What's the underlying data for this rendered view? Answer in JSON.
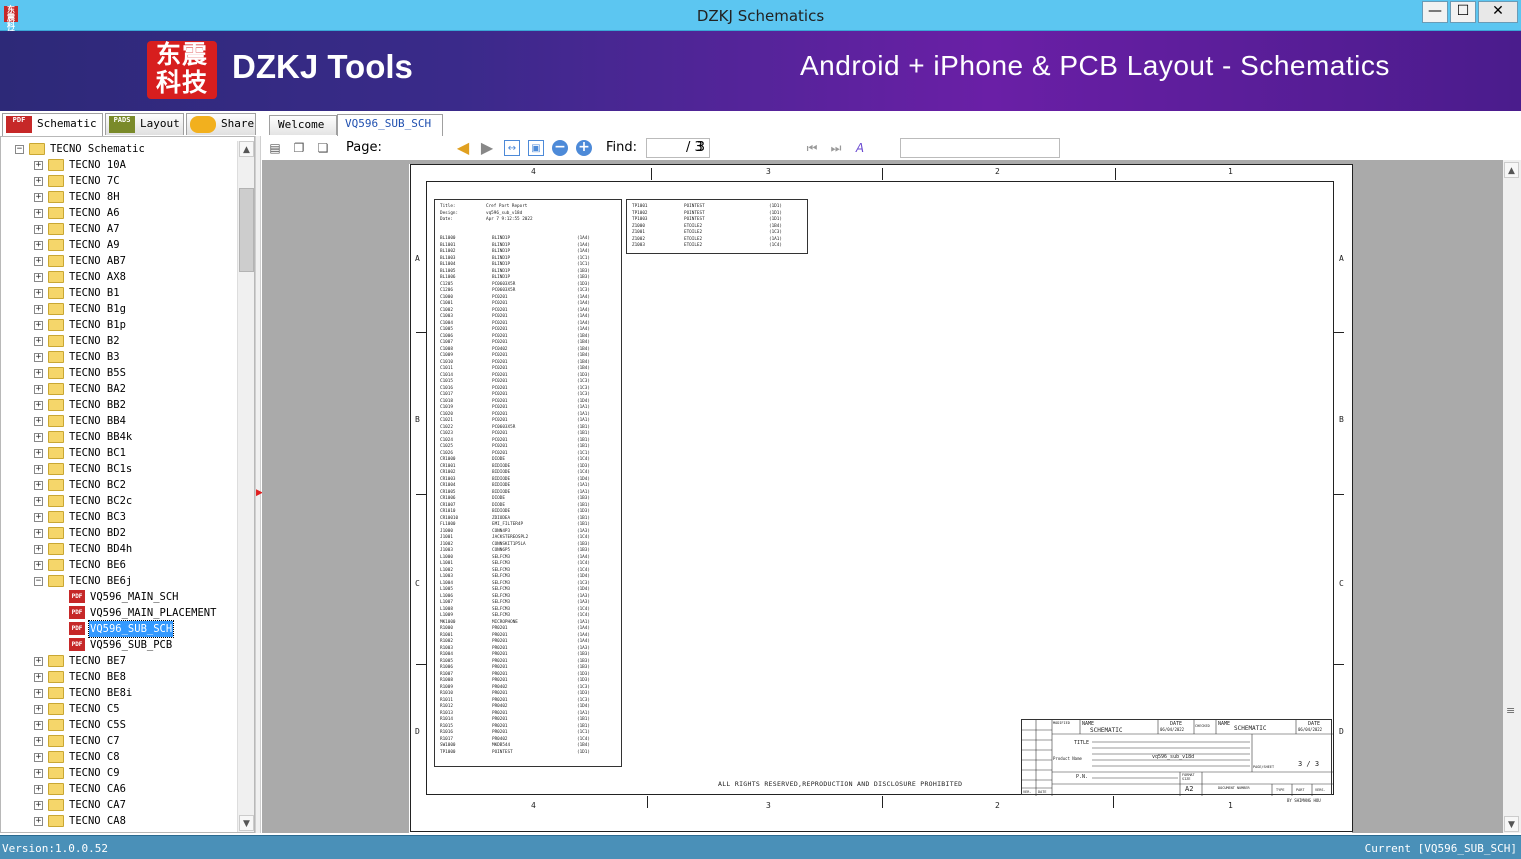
{
  "window": {
    "title": "DZKJ Schematics",
    "app_icon_text": "东震科技",
    "minimize": "—",
    "maximize": "☐",
    "close": "✕"
  },
  "banner": {
    "logo_text": "东震科技",
    "brand": "DZKJ Tools",
    "tagline": "Android + iPhone & PCB Layout - Schematics"
  },
  "left_tabs": [
    {
      "label": "Schematic",
      "icon": "pdf-icon",
      "icon_text": "PDF"
    },
    {
      "label": "Layout",
      "icon": "pads-icon",
      "icon_text": "PADS"
    },
    {
      "label": "Share",
      "icon": "share-icon",
      "icon_text": ""
    }
  ],
  "doc_tabs": [
    {
      "label": "Welcome"
    },
    {
      "label": "VQ596_SUB_SCH"
    }
  ],
  "tree": {
    "root": "TECNO Schematic",
    "folders_before": [
      "TECNO 10A",
      "TECNO 7C",
      "TECNO 8H",
      "TECNO A6",
      "TECNO A7",
      "TECNO A9",
      "TECNO AB7",
      "TECNO AX8",
      "TECNO B1",
      "TECNO B1g",
      "TECNO B1p",
      "TECNO B2",
      "TECNO B3",
      "TECNO B5S",
      "TECNO BA2",
      "TECNO BB2",
      "TECNO BB4",
      "TECNO BB4k",
      "TECNO BC1",
      "TECNO BC1s",
      "TECNO BC2",
      "TECNO BC2c",
      "TECNO BC3",
      "TECNO BD2",
      "TECNO BD4h",
      "TECNO BE6"
    ],
    "expanded_folder": "TECNO BE6j",
    "files": [
      "VQ596_MAIN_SCH",
      "VQ596_MAIN_PLACEMENT",
      "VQ596_SUB_SCH",
      "VQ596_SUB_PCB"
    ],
    "selected_file": "VQ596_SUB_SCH",
    "folders_after": [
      "TECNO BE7",
      "TECNO BE8",
      "TECNO BE8i",
      "TECNO C5",
      "TECNO C5S",
      "TECNO C7",
      "TECNO C8",
      "TECNO C9",
      "TECNO CA6",
      "TECNO CA7",
      "TECNO CA8"
    ]
  },
  "toolbar": {
    "page_label": "Page:",
    "page_current": "3",
    "page_total": "/ 3",
    "find_label": "Find:",
    "find_value": ""
  },
  "sheet": {
    "col_labels": [
      "4",
      "3",
      "2",
      "1"
    ],
    "row_labels": [
      "A",
      "B",
      "C",
      "D"
    ],
    "bom_header": [
      [
        "Title:",
        "Cref Part Report"
      ],
      [
        "Design:",
        "vq596_sub_v18d"
      ],
      [
        "Date:",
        "Apr 7 9:12:55 2022"
      ]
    ],
    "bom_rows": [
      [
        "BL1000",
        "BLIND1P",
        "(1A4)"
      ],
      [
        "BL1001",
        "BLIND1P",
        "(1A4)"
      ],
      [
        "BL1002",
        "BLIND1P",
        "(1A4)"
      ],
      [
        "BL1003",
        "BLIND1P",
        "(1C1)"
      ],
      [
        "BL1004",
        "BLIND1P",
        "(1C1)"
      ],
      [
        "BL1005",
        "BLIND1P",
        "(1B3)"
      ],
      [
        "BL1006",
        "BLIND1P",
        "(1B3)"
      ],
      [
        "C1205",
        "PC0603X5R",
        "(1D3)"
      ],
      [
        "C1206",
        "PC0603X5R",
        "(1C3)"
      ],
      [
        "C1000",
        "PC0201",
        "(1A4)"
      ],
      [
        "C1001",
        "PC0201",
        "(1A4)"
      ],
      [
        "C1002",
        "PC0201",
        "(1A4)"
      ],
      [
        "C1003",
        "PC0201",
        "(1A4)"
      ],
      [
        "C1004",
        "PC0201",
        "(1A4)"
      ],
      [
        "C1005",
        "PC0201",
        "(1A4)"
      ],
      [
        "C1006",
        "PC0201",
        "(1B4)"
      ],
      [
        "C1007",
        "PC0201",
        "(1B4)"
      ],
      [
        "C1008",
        "PC0402",
        "(1B4)"
      ],
      [
        "C1009",
        "PC0201",
        "(1B4)"
      ],
      [
        "C1010",
        "PC0201",
        "(1B4)"
      ],
      [
        "C1011",
        "PC0201",
        "(1B4)"
      ],
      [
        "C1014",
        "PC0201",
        "(1D3)"
      ],
      [
        "C1015",
        "PC0201",
        "(1C3)"
      ],
      [
        "C1016",
        "PC0201",
        "(1C3)"
      ],
      [
        "C1017",
        "PC0201",
        "(1C3)"
      ],
      [
        "C1018",
        "PC0201",
        "(1D4)"
      ],
      [
        "C1019",
        "PC0201",
        "(1A1)"
      ],
      [
        "C1020",
        "PC0201",
        "(1A1)"
      ],
      [
        "C1021",
        "PC0201",
        "(1A1)"
      ],
      [
        "C1022",
        "PC0603X5R",
        "(1B1)"
      ],
      [
        "C1023",
        "PC0201",
        "(1B1)"
      ],
      [
        "C1024",
        "PC0201",
        "(1B1)"
      ],
      [
        "C1025",
        "PC0201",
        "(1B1)"
      ],
      [
        "C1026",
        "PC0201",
        "(1C1)"
      ],
      [
        "CR1000",
        "DIODE",
        "(1C4)"
      ],
      [
        "CR1001",
        "BIDIODE",
        "(1D3)"
      ],
      [
        "CR1002",
        "BIDIODE",
        "(1C4)"
      ],
      [
        "CR1003",
        "BIDIODE",
        "(1D4)"
      ],
      [
        "CR1004",
        "BIDIODE",
        "(1A1)"
      ],
      [
        "CR1005",
        "BIDIODE",
        "(1A1)"
      ],
      [
        "CR1006",
        "DIODE",
        "(1B3)"
      ],
      [
        "CR1007",
        "DIODE",
        "(1B1)"
      ],
      [
        "CR1010",
        "BIDIODE",
        "(1D3)"
      ],
      [
        "CR10010",
        "ZDIODEA",
        "(1B1)"
      ],
      [
        "FL1000",
        "EMI_FILTER4P",
        "(1B1)"
      ],
      [
        "J1000",
        "CONN4P3",
        "(1A3)"
      ],
      [
        "J1001",
        "JACKSTEREOSPL2",
        "(1C4)"
      ],
      [
        "J1002",
        "CONNSKIT1P5LA",
        "(1B3)"
      ],
      [
        "J1003",
        "CONN6P5",
        "(1B3)"
      ],
      [
        "L1000",
        "SELFCM3",
        "(1A4)"
      ],
      [
        "L1001",
        "SELFCM3",
        "(1C4)"
      ],
      [
        "L1002",
        "SELFCM3",
        "(1C4)"
      ],
      [
        "L1003",
        "SELFCM3",
        "(1D4)"
      ],
      [
        "L1004",
        "SELFCM3",
        "(1C3)"
      ],
      [
        "L1005",
        "SELFCM3",
        "(1D4)"
      ],
      [
        "L1006",
        "SELFCM3",
        "(1A3)"
      ],
      [
        "L1007",
        "SELFCM3",
        "(1A3)"
      ],
      [
        "L1008",
        "SELFCM3",
        "(1C4)"
      ],
      [
        "L1009",
        "SELFCM3",
        "(1C4)"
      ],
      [
        "MK1000",
        "MICROPHONE",
        "(1A1)"
      ],
      [
        "R1000",
        "PR0201",
        "(1A4)"
      ],
      [
        "R1001",
        "PR0201",
        "(1A4)"
      ],
      [
        "R1002",
        "PR0201",
        "(1A4)"
      ],
      [
        "R1003",
        "PR0201",
        "(1A3)"
      ],
      [
        "R1004",
        "PR0201",
        "(1B3)"
      ],
      [
        "R1005",
        "PR0201",
        "(1B3)"
      ],
      [
        "R1006",
        "PR0201",
        "(1B3)"
      ],
      [
        "R1007",
        "PR0201",
        "(1D3)"
      ],
      [
        "R1008",
        "PR0201",
        "(1D3)"
      ],
      [
        "R1009",
        "PR0402",
        "(1C3)"
      ],
      [
        "R1010",
        "PR0201",
        "(1D3)"
      ],
      [
        "R1011",
        "PR0201",
        "(1C3)"
      ],
      [
        "R1012",
        "PR0402",
        "(1D4)"
      ],
      [
        "R1013",
        "PR0201",
        "(1A1)"
      ],
      [
        "R1014",
        "PR0201",
        "(1B1)"
      ],
      [
        "R1015",
        "PR0201",
        "(1B1)"
      ],
      [
        "R1016",
        "PR0201",
        "(1C1)"
      ],
      [
        "R1017",
        "PR0402",
        "(1C4)"
      ],
      [
        "SW1000",
        "MKDB544",
        "(1B4)"
      ],
      [
        "TP1000",
        "POINTEST",
        "(1D1)"
      ]
    ],
    "bom2_rows": [
      [
        "TP1001",
        "POINTEST",
        "(1D1)"
      ],
      [
        "TP1002",
        "POINTEST",
        "(1D1)"
      ],
      [
        "TP1003",
        "POINTEST",
        "(1D1)"
      ],
      [
        "Z1000",
        "ETOILE2",
        "(1B4)"
      ],
      [
        "Z1001",
        "ETOILE2",
        "(1C3)"
      ],
      [
        "Z1002",
        "ETOILE2",
        "(1A1)"
      ],
      [
        "Z1003",
        "ETOILE2",
        "(1C4)"
      ]
    ],
    "footer_note": "ALL RIGHTS RESERVED,REPRODUCTION AND DISCLOSURE PROHIBITED",
    "title_block": {
      "modified": "MODIFIED",
      "name1": "NAME",
      "schematic1": "SCHEMATIC",
      "date1": "DATE",
      "date1_val": "06/04/2022",
      "checked": "CHECKED",
      "name2": "NAME",
      "schematic2": "SCHEMATIC",
      "date2": "DATE",
      "date2_val": "06/04/2022",
      "title": "TITLE",
      "product_name": "Product Name",
      "product_val": "vq596_sub_v18d",
      "page_sheet": "PAGE/SHEET",
      "page_sheet_val": "3 / 3",
      "pn": "P.N.",
      "format_size": "FORMAT SIZE",
      "format_val": "A2",
      "doc_number": "DOCUMENT NUMBER",
      "type": "TYPE",
      "part": "PART",
      "vers": "VERS.",
      "vers_col": "VER.",
      "date_col": "DATE",
      "author": "BY SHIMANG HOU"
    }
  },
  "status": {
    "version": "Version:1.0.0.52",
    "current": "Current [VQ596_SUB_SCH]"
  }
}
